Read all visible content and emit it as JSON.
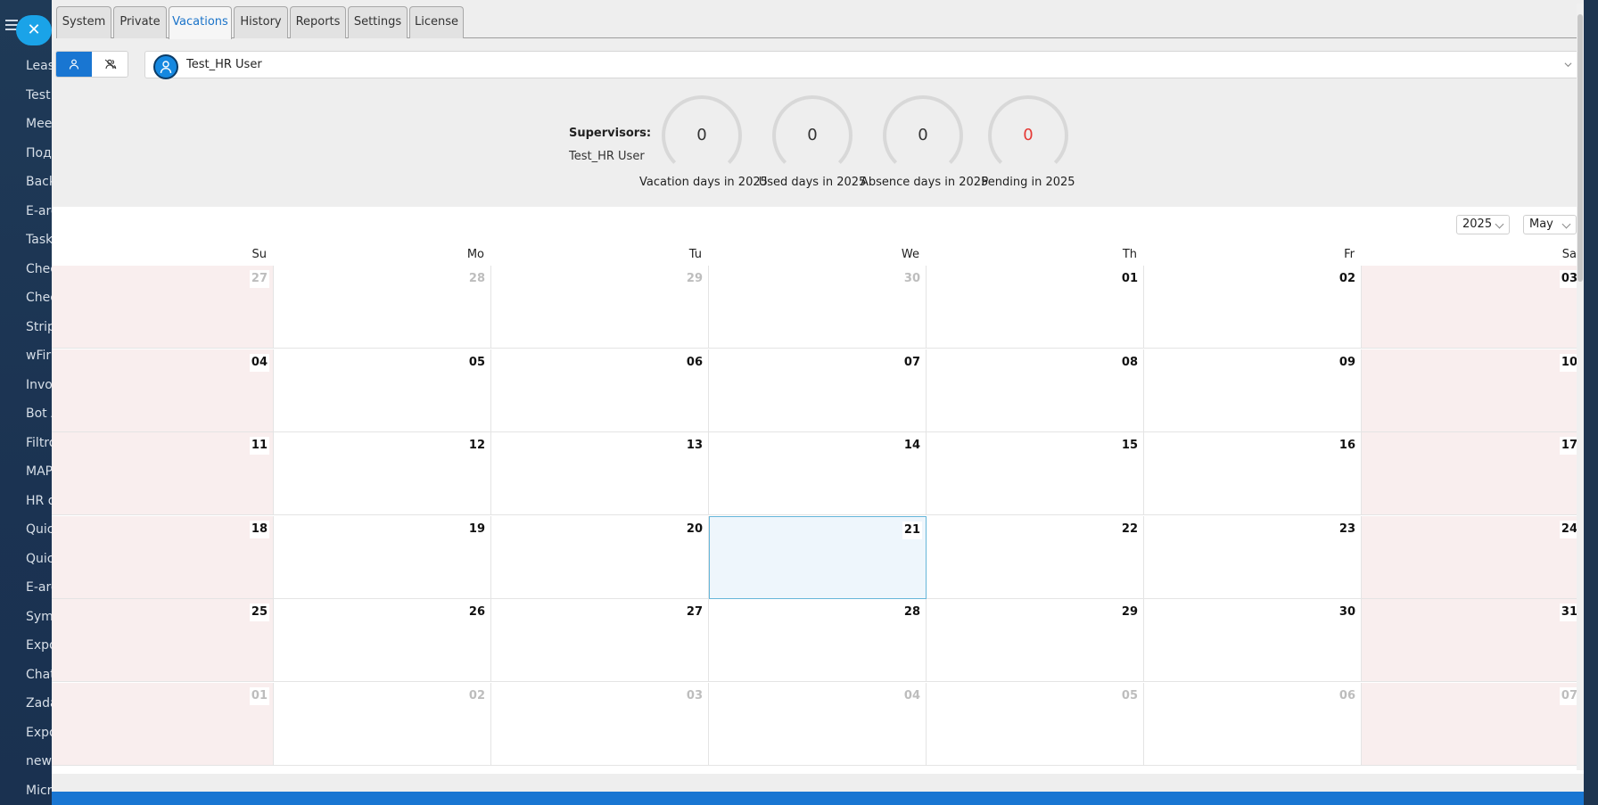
{
  "background_sidebar": {
    "items": [
      "Leas",
      "Test",
      "Meet",
      "Подо",
      "Back",
      "E-arc",
      "TaskT",
      "Chec",
      "Chec",
      "Strip",
      "wFirr",
      "Invoi",
      "Bot A",
      "Filtro",
      "MAP",
      "HR d",
      "Quic",
      "Quic",
      "E-arc",
      "Symf",
      "Expo",
      "Chat",
      "Zada",
      "Expo",
      "new/",
      "Micr"
    ]
  },
  "close_label": "✕",
  "tabs": [
    {
      "label": "System"
    },
    {
      "label": "Private"
    },
    {
      "label": "Vacations"
    },
    {
      "label": "History"
    },
    {
      "label": "Reports"
    },
    {
      "label": "Settings"
    },
    {
      "label": "License"
    }
  ],
  "active_tab": "Vacations",
  "user_select": {
    "value": "Test_HR User"
  },
  "supervisors": {
    "label": "Supervisors:",
    "name": "Test_HR User"
  },
  "stats": [
    {
      "value": "0",
      "label": "Vacation days in 2025"
    },
    {
      "value": "0",
      "label": "Used days in 2025"
    },
    {
      "value": "0",
      "label": "Absence days in 2025"
    },
    {
      "value": "0",
      "label": "Pending in 2025",
      "color": "#e53935"
    }
  ],
  "calendar": {
    "year": "2025",
    "month": "May",
    "weekdays": [
      "Su",
      "Mo",
      "Tu",
      "We",
      "Th",
      "Fr",
      "Sa"
    ],
    "weeks": [
      [
        {
          "d": "27",
          "o": true
        },
        {
          "d": "28",
          "o": true
        },
        {
          "d": "29",
          "o": true
        },
        {
          "d": "30",
          "o": true
        },
        {
          "d": "01"
        },
        {
          "d": "02"
        },
        {
          "d": "03"
        }
      ],
      [
        {
          "d": "04"
        },
        {
          "d": "05"
        },
        {
          "d": "06"
        },
        {
          "d": "07"
        },
        {
          "d": "08"
        },
        {
          "d": "09"
        },
        {
          "d": "10"
        }
      ],
      [
        {
          "d": "11"
        },
        {
          "d": "12"
        },
        {
          "d": "13"
        },
        {
          "d": "14"
        },
        {
          "d": "15"
        },
        {
          "d": "16"
        },
        {
          "d": "17"
        }
      ],
      [
        {
          "d": "18"
        },
        {
          "d": "19"
        },
        {
          "d": "20"
        },
        {
          "d": "21",
          "today": true
        },
        {
          "d": "22"
        },
        {
          "d": "23"
        },
        {
          "d": "24"
        }
      ],
      [
        {
          "d": "25"
        },
        {
          "d": "26"
        },
        {
          "d": "27"
        },
        {
          "d": "28"
        },
        {
          "d": "29"
        },
        {
          "d": "30"
        },
        {
          "d": "31"
        }
      ],
      [
        {
          "d": "01",
          "o": true
        },
        {
          "d": "02",
          "o": true
        },
        {
          "d": "03",
          "o": true
        },
        {
          "d": "04",
          "o": true
        },
        {
          "d": "05",
          "o": true
        },
        {
          "d": "06",
          "o": true
        },
        {
          "d": "07",
          "o": true
        }
      ]
    ]
  },
  "colors": {
    "accent": "#1976d2",
    "weekend": "#f9eeee",
    "today": "#eef6fc"
  }
}
